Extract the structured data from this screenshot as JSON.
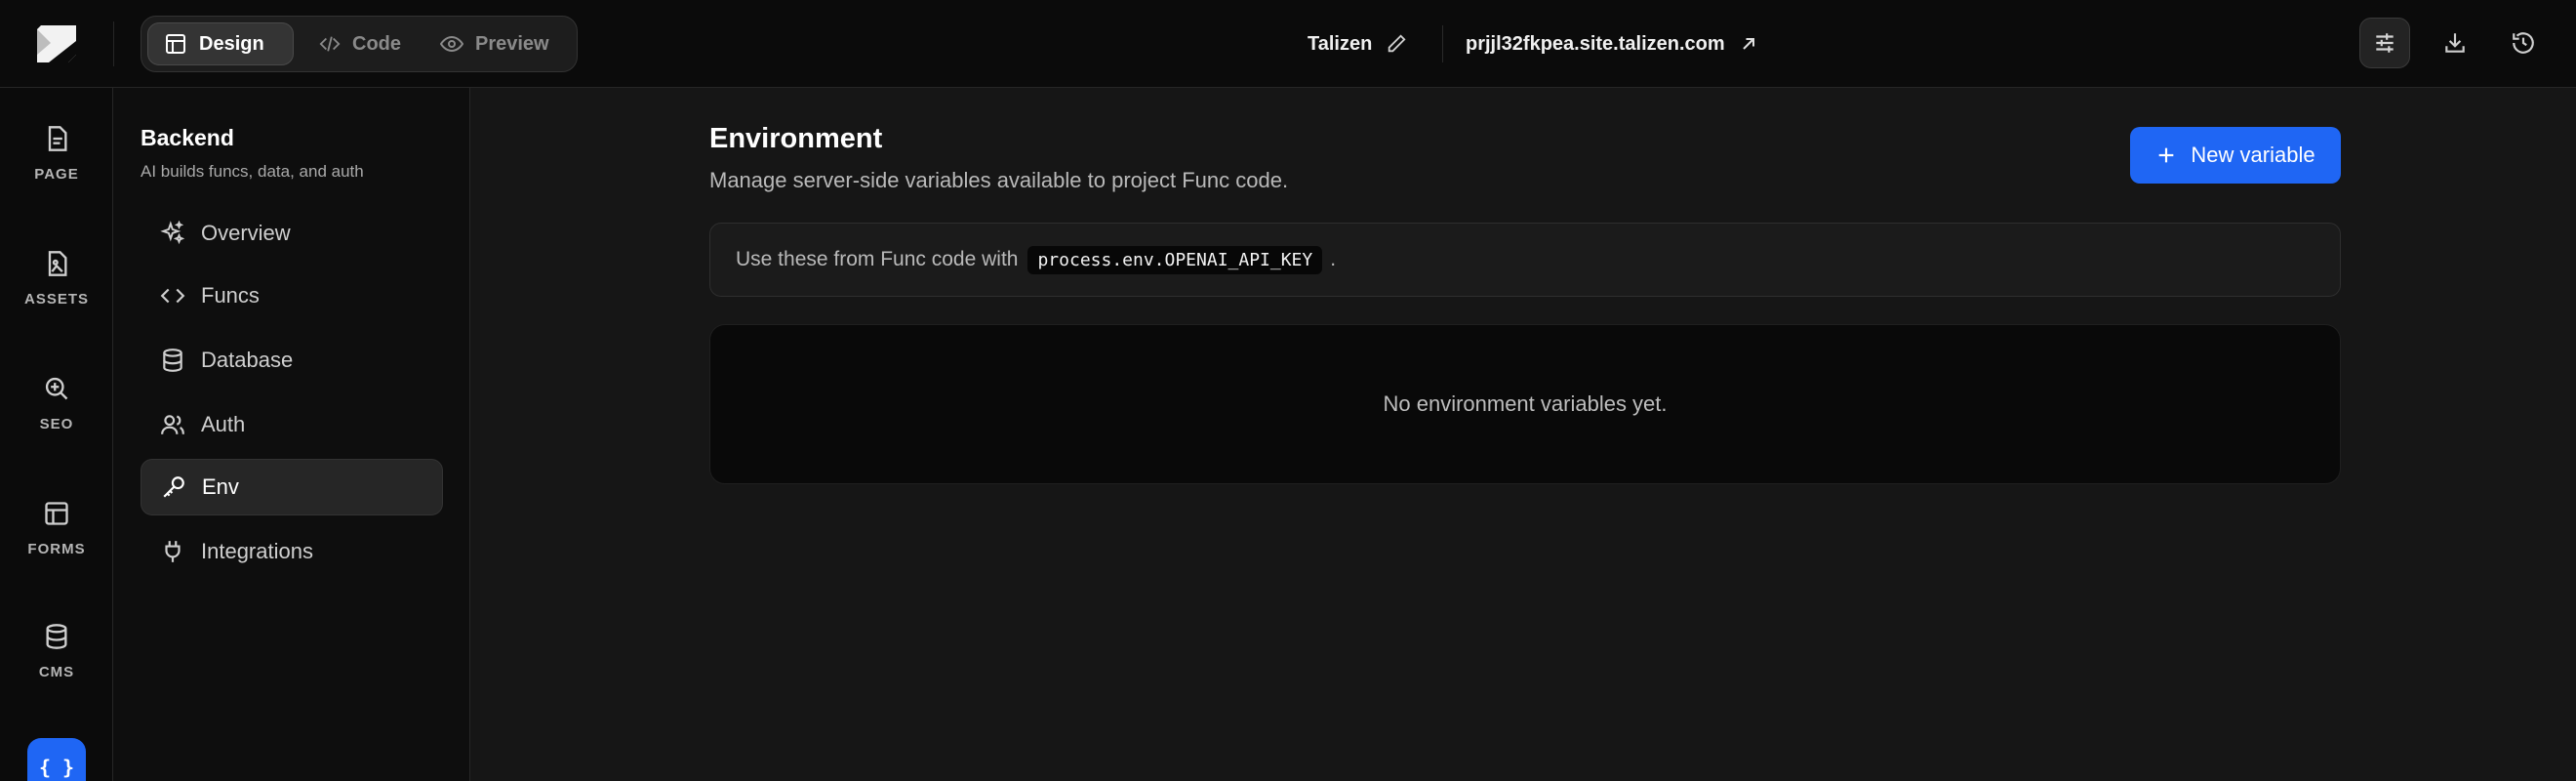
{
  "topbar": {
    "modes": [
      {
        "label": "Design",
        "active": true
      },
      {
        "label": "Code",
        "active": false
      },
      {
        "label": "Preview",
        "active": false
      }
    ],
    "project_name": "Talizen",
    "site_url": "prjjl32fkpea.site.talizen.com",
    "icons": [
      "settings-sliders-icon",
      "download-icon",
      "history-icon"
    ]
  },
  "rail": {
    "items": [
      {
        "label": "PAGE",
        "icon": "page-icon"
      },
      {
        "label": "ASSETS",
        "icon": "assets-icon"
      },
      {
        "label": "SEO",
        "icon": "seo-icon"
      },
      {
        "label": "FORMS",
        "icon": "forms-icon"
      },
      {
        "label": "CMS",
        "icon": "cms-icon"
      }
    ],
    "code_button": "{ }"
  },
  "sidebar": {
    "title": "Backend",
    "subtitle": "AI builds funcs, data, and auth",
    "items": [
      {
        "label": "Overview",
        "icon": "sparkles-icon"
      },
      {
        "label": "Funcs",
        "icon": "code-icon"
      },
      {
        "label": "Database",
        "icon": "database-icon"
      },
      {
        "label": "Auth",
        "icon": "users-icon"
      },
      {
        "label": "Env",
        "icon": "key-icon",
        "active": true
      },
      {
        "label": "Integrations",
        "icon": "plug-icon"
      }
    ]
  },
  "main": {
    "title": "Environment",
    "description": "Manage server-side variables available to project Func code.",
    "new_button": "New variable",
    "hint_prefix": "Use these from Func code with",
    "hint_code": "process.env.OPENAI_API_KEY",
    "hint_suffix": ".",
    "empty_text": "No environment variables yet."
  },
  "colors": {
    "accent": "#1f66f4",
    "background": "#161616",
    "chrome": "#0b0b0b"
  }
}
